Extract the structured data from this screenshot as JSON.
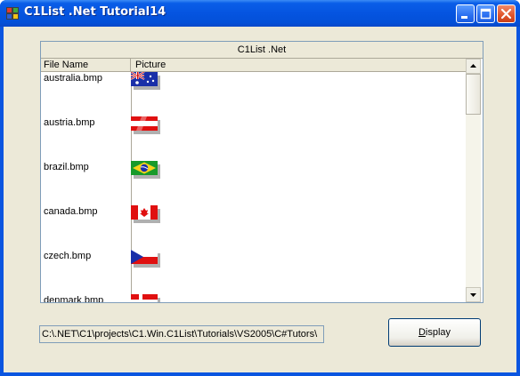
{
  "window": {
    "title": "C1List .Net Tutorial14",
    "buttons": [
      "minimize",
      "maximize",
      "close"
    ]
  },
  "list": {
    "caption": "C1List .Net",
    "columns": [
      "File Name",
      "Picture"
    ],
    "rows": [
      {
        "file": "australia.bmp",
        "flag": "australia-flag"
      },
      {
        "file": "austria.bmp",
        "flag": "austria-flag"
      },
      {
        "file": "brazil.bmp",
        "flag": "brazil-flag"
      },
      {
        "file": "canada.bmp",
        "flag": "canada-flag"
      },
      {
        "file": "czech.bmp",
        "flag": "czech-flag"
      },
      {
        "file": "denmark.bmp",
        "flag": "denmark-flag"
      }
    ]
  },
  "path_field": {
    "value": "C:\\.NET\\C1\\projects\\C1.Win.C1List\\Tutorials\\VS2005\\C#Tutors\\"
  },
  "display_button": {
    "accel": "D",
    "rest": "isplay"
  }
}
